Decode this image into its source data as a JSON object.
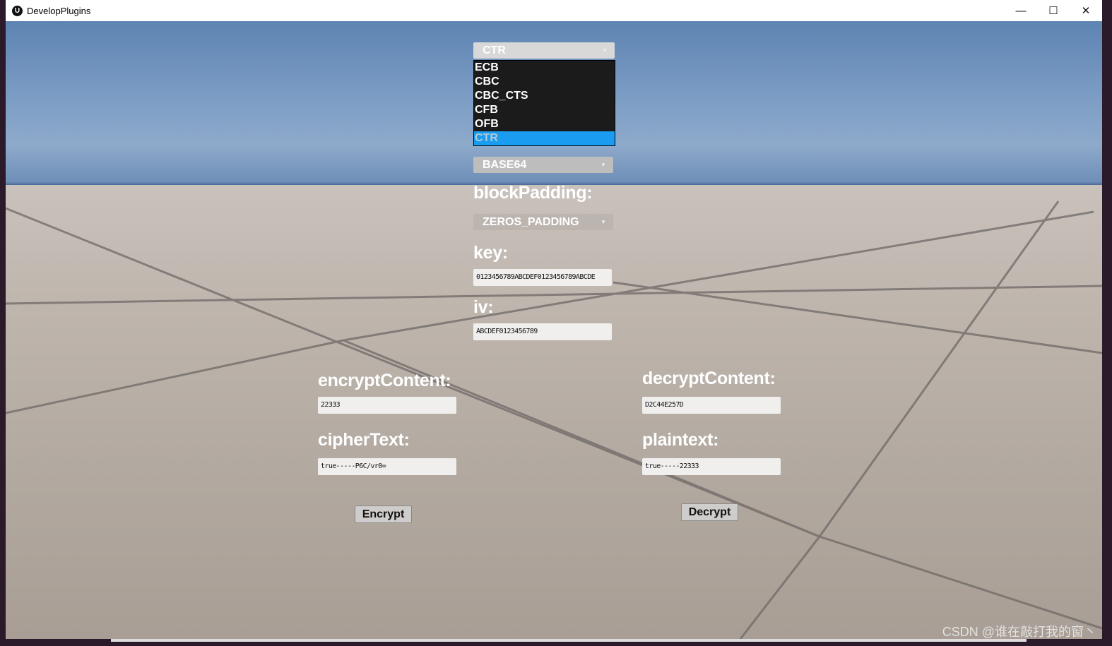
{
  "window": {
    "title": "DevelopPlugins",
    "minimize": "—",
    "maximize": "☐",
    "close": "✕"
  },
  "mode": {
    "selected": "CTR",
    "options": [
      "ECB",
      "CBC",
      "CBC_CTS",
      "CFB",
      "OFB",
      "CTR"
    ]
  },
  "encoding": {
    "selected": "BASE64"
  },
  "blockPadding": {
    "label": "blockPadding:",
    "selected": "ZEROS_PADDING"
  },
  "key": {
    "label": "key:",
    "value": "0123456789ABCDEF0123456789ABCDE"
  },
  "iv": {
    "label": "iv:",
    "value": "ABCDEF0123456789"
  },
  "encrypt": {
    "content_label": "encryptContent:",
    "content_value": "22333",
    "cipher_label": "cipherText:",
    "cipher_value": "true-----P6C/vr0=",
    "button": "Encrypt"
  },
  "decrypt": {
    "content_label": "decryptContent:",
    "content_value": "D2C44E257D",
    "plain_label": "plaintext:",
    "plain_value": "true-----22333",
    "button": "Decrypt"
  },
  "watermark": "CSDN @谁在敲打我的窗丶"
}
